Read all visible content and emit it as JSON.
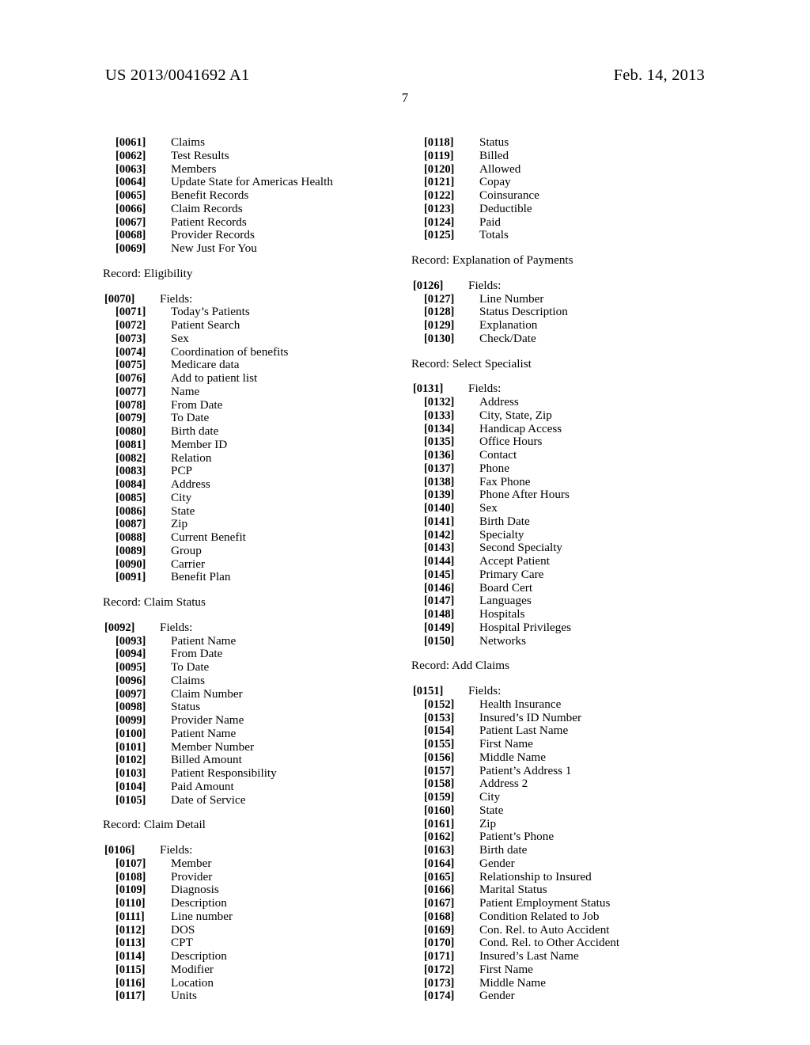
{
  "header": {
    "publication_number": "US 2013/0041692 A1",
    "publication_date": "Feb. 14, 2013",
    "page_number": "7"
  },
  "left_column": [
    {
      "type": "entry",
      "level": 2,
      "num": "[0061]",
      "label": "Claims"
    },
    {
      "type": "entry",
      "level": 2,
      "num": "[0062]",
      "label": "Test Results"
    },
    {
      "type": "entry",
      "level": 2,
      "num": "[0063]",
      "label": "Members"
    },
    {
      "type": "entry",
      "level": 2,
      "num": "[0064]",
      "label": "Update State for Americas Health"
    },
    {
      "type": "entry",
      "level": 2,
      "num": "[0065]",
      "label": "Benefit Records"
    },
    {
      "type": "entry",
      "level": 2,
      "num": "[0066]",
      "label": "Claim Records"
    },
    {
      "type": "entry",
      "level": 2,
      "num": "[0067]",
      "label": "Patient Records"
    },
    {
      "type": "entry",
      "level": 2,
      "num": "[0068]",
      "label": "Provider Records"
    },
    {
      "type": "entry",
      "level": 2,
      "num": "[0069]",
      "label": "New Just For You"
    },
    {
      "type": "gap"
    },
    {
      "type": "record",
      "text": "Record: Eligibility"
    },
    {
      "type": "gap"
    },
    {
      "type": "entry",
      "level": 1,
      "num": "[0070]",
      "label": "Fields:"
    },
    {
      "type": "entry",
      "level": 2,
      "num": "[0071]",
      "label": "Today’s Patients"
    },
    {
      "type": "entry",
      "level": 2,
      "num": "[0072]",
      "label": "Patient Search"
    },
    {
      "type": "entry",
      "level": 2,
      "num": "[0073]",
      "label": "Sex"
    },
    {
      "type": "entry",
      "level": 2,
      "num": "[0074]",
      "label": "Coordination of benefits"
    },
    {
      "type": "entry",
      "level": 2,
      "num": "[0075]",
      "label": "Medicare data"
    },
    {
      "type": "entry",
      "level": 2,
      "num": "[0076]",
      "label": "Add to patient list"
    },
    {
      "type": "entry",
      "level": 2,
      "num": "[0077]",
      "label": "Name"
    },
    {
      "type": "entry",
      "level": 2,
      "num": "[0078]",
      "label": "From Date"
    },
    {
      "type": "entry",
      "level": 2,
      "num": "[0079]",
      "label": "To Date"
    },
    {
      "type": "entry",
      "level": 2,
      "num": "[0080]",
      "label": "Birth date"
    },
    {
      "type": "entry",
      "level": 2,
      "num": "[0081]",
      "label": "Member ID"
    },
    {
      "type": "entry",
      "level": 2,
      "num": "[0082]",
      "label": "Relation"
    },
    {
      "type": "entry",
      "level": 2,
      "num": "[0083]",
      "label": "PCP"
    },
    {
      "type": "entry",
      "level": 2,
      "num": "[0084]",
      "label": "Address"
    },
    {
      "type": "entry",
      "level": 2,
      "num": "[0085]",
      "label": "City"
    },
    {
      "type": "entry",
      "level": 2,
      "num": "[0086]",
      "label": "State"
    },
    {
      "type": "entry",
      "level": 2,
      "num": "[0087]",
      "label": "Zip"
    },
    {
      "type": "entry",
      "level": 2,
      "num": "[0088]",
      "label": "Current Benefit"
    },
    {
      "type": "entry",
      "level": 2,
      "num": "[0089]",
      "label": "Group"
    },
    {
      "type": "entry",
      "level": 2,
      "num": "[0090]",
      "label": "Carrier"
    },
    {
      "type": "entry",
      "level": 2,
      "num": "[0091]",
      "label": "Benefit Plan"
    },
    {
      "type": "gap"
    },
    {
      "type": "record",
      "text": "Record: Claim Status"
    },
    {
      "type": "gap"
    },
    {
      "type": "entry",
      "level": 1,
      "num": "[0092]",
      "label": "Fields:"
    },
    {
      "type": "entry",
      "level": 2,
      "num": "[0093]",
      "label": "Patient Name"
    },
    {
      "type": "entry",
      "level": 2,
      "num": "[0094]",
      "label": "From Date"
    },
    {
      "type": "entry",
      "level": 2,
      "num": "[0095]",
      "label": "To Date"
    },
    {
      "type": "entry",
      "level": 2,
      "num": "[0096]",
      "label": "Claims"
    },
    {
      "type": "entry",
      "level": 2,
      "num": "[0097]",
      "label": "Claim Number"
    },
    {
      "type": "entry",
      "level": 2,
      "num": "[0098]",
      "label": "Status"
    },
    {
      "type": "entry",
      "level": 2,
      "num": "[0099]",
      "label": "Provider Name"
    },
    {
      "type": "entry",
      "level": 2,
      "num": "[0100]",
      "label": "Patient Name"
    },
    {
      "type": "entry",
      "level": 2,
      "num": "[0101]",
      "label": "Member Number"
    },
    {
      "type": "entry",
      "level": 2,
      "num": "[0102]",
      "label": "Billed Amount"
    },
    {
      "type": "entry",
      "level": 2,
      "num": "[0103]",
      "label": "Patient Responsibility"
    },
    {
      "type": "entry",
      "level": 2,
      "num": "[0104]",
      "label": "Paid Amount"
    },
    {
      "type": "entry",
      "level": 2,
      "num": "[0105]",
      "label": "Date of Service"
    },
    {
      "type": "gap"
    },
    {
      "type": "record",
      "text": "Record: Claim Detail"
    },
    {
      "type": "gap"
    },
    {
      "type": "entry",
      "level": 1,
      "num": "[0106]",
      "label": "Fields:"
    },
    {
      "type": "entry",
      "level": 2,
      "num": "[0107]",
      "label": "Member"
    },
    {
      "type": "entry",
      "level": 2,
      "num": "[0108]",
      "label": "Provider"
    },
    {
      "type": "entry",
      "level": 2,
      "num": "[0109]",
      "label": "Diagnosis"
    },
    {
      "type": "entry",
      "level": 2,
      "num": "[0110]",
      "label": "Description"
    },
    {
      "type": "entry",
      "level": 2,
      "num": "[0111]",
      "label": "Line number"
    },
    {
      "type": "entry",
      "level": 2,
      "num": "[0112]",
      "label": "DOS"
    },
    {
      "type": "entry",
      "level": 2,
      "num": "[0113]",
      "label": "CPT"
    },
    {
      "type": "entry",
      "level": 2,
      "num": "[0114]",
      "label": "Description"
    },
    {
      "type": "entry",
      "level": 2,
      "num": "[0115]",
      "label": "Modifier"
    },
    {
      "type": "entry",
      "level": 2,
      "num": "[0116]",
      "label": "Location"
    },
    {
      "type": "entry",
      "level": 2,
      "num": "[0117]",
      "label": "Units"
    }
  ],
  "right_column": [
    {
      "type": "entry",
      "level": 2,
      "num": "[0118]",
      "label": "Status"
    },
    {
      "type": "entry",
      "level": 2,
      "num": "[0119]",
      "label": "Billed"
    },
    {
      "type": "entry",
      "level": 2,
      "num": "[0120]",
      "label": "Allowed"
    },
    {
      "type": "entry",
      "level": 2,
      "num": "[0121]",
      "label": "Copay"
    },
    {
      "type": "entry",
      "level": 2,
      "num": "[0122]",
      "label": "Coinsurance"
    },
    {
      "type": "entry",
      "level": 2,
      "num": "[0123]",
      "label": "Deductible"
    },
    {
      "type": "entry",
      "level": 2,
      "num": "[0124]",
      "label": "Paid"
    },
    {
      "type": "entry",
      "level": 2,
      "num": "[0125]",
      "label": "Totals"
    },
    {
      "type": "gap"
    },
    {
      "type": "record",
      "text": "Record: Explanation of Payments"
    },
    {
      "type": "gap"
    },
    {
      "type": "entry",
      "level": 1,
      "num": "[0126]",
      "label": "Fields:"
    },
    {
      "type": "entry",
      "level": 2,
      "num": "[0127]",
      "label": "Line Number"
    },
    {
      "type": "entry",
      "level": 2,
      "num": "[0128]",
      "label": "Status Description"
    },
    {
      "type": "entry",
      "level": 2,
      "num": "[0129]",
      "label": "Explanation"
    },
    {
      "type": "entry",
      "level": 2,
      "num": "[0130]",
      "label": "Check/Date"
    },
    {
      "type": "gap"
    },
    {
      "type": "record",
      "text": "Record: Select Specialist"
    },
    {
      "type": "gap"
    },
    {
      "type": "entry",
      "level": 1,
      "num": "[0131]",
      "label": "Fields:"
    },
    {
      "type": "entry",
      "level": 2,
      "num": "[0132]",
      "label": "Address"
    },
    {
      "type": "entry",
      "level": 2,
      "num": "[0133]",
      "label": "City, State, Zip"
    },
    {
      "type": "entry",
      "level": 2,
      "num": "[0134]",
      "label": "Handicap Access"
    },
    {
      "type": "entry",
      "level": 2,
      "num": "[0135]",
      "label": "Office Hours"
    },
    {
      "type": "entry",
      "level": 2,
      "num": "[0136]",
      "label": "Contact"
    },
    {
      "type": "entry",
      "level": 2,
      "num": "[0137]",
      "label": "Phone"
    },
    {
      "type": "entry",
      "level": 2,
      "num": "[0138]",
      "label": "Fax Phone"
    },
    {
      "type": "entry",
      "level": 2,
      "num": "[0139]",
      "label": "Phone After Hours"
    },
    {
      "type": "entry",
      "level": 2,
      "num": "[0140]",
      "label": "Sex"
    },
    {
      "type": "entry",
      "level": 2,
      "num": "[0141]",
      "label": "Birth Date"
    },
    {
      "type": "entry",
      "level": 2,
      "num": "[0142]",
      "label": "Specialty"
    },
    {
      "type": "entry",
      "level": 2,
      "num": "[0143]",
      "label": "Second Specialty"
    },
    {
      "type": "entry",
      "level": 2,
      "num": "[0144]",
      "label": "Accept Patient"
    },
    {
      "type": "entry",
      "level": 2,
      "num": "[0145]",
      "label": "Primary Care"
    },
    {
      "type": "entry",
      "level": 2,
      "num": "[0146]",
      "label": "Board Cert"
    },
    {
      "type": "entry",
      "level": 2,
      "num": "[0147]",
      "label": "Languages"
    },
    {
      "type": "entry",
      "level": 2,
      "num": "[0148]",
      "label": "Hospitals"
    },
    {
      "type": "entry",
      "level": 2,
      "num": "[0149]",
      "label": "Hospital Privileges"
    },
    {
      "type": "entry",
      "level": 2,
      "num": "[0150]",
      "label": "Networks"
    },
    {
      "type": "gap"
    },
    {
      "type": "record",
      "text": "Record: Add Claims"
    },
    {
      "type": "gap"
    },
    {
      "type": "entry",
      "level": 1,
      "num": "[0151]",
      "label": "Fields:"
    },
    {
      "type": "entry",
      "level": 2,
      "num": "[0152]",
      "label": "Health Insurance"
    },
    {
      "type": "entry",
      "level": 2,
      "num": "[0153]",
      "label": "Insured’s ID Number"
    },
    {
      "type": "entry",
      "level": 2,
      "num": "[0154]",
      "label": "Patient Last Name"
    },
    {
      "type": "entry",
      "level": 2,
      "num": "[0155]",
      "label": "First Name"
    },
    {
      "type": "entry",
      "level": 2,
      "num": "[0156]",
      "label": "Middle Name"
    },
    {
      "type": "entry",
      "level": 2,
      "num": "[0157]",
      "label": "Patient’s Address 1"
    },
    {
      "type": "entry",
      "level": 2,
      "num": "[0158]",
      "label": "Address 2"
    },
    {
      "type": "entry",
      "level": 2,
      "num": "[0159]",
      "label": "City"
    },
    {
      "type": "entry",
      "level": 2,
      "num": "[0160]",
      "label": "State"
    },
    {
      "type": "entry",
      "level": 2,
      "num": "[0161]",
      "label": "Zip"
    },
    {
      "type": "entry",
      "level": 2,
      "num": "[0162]",
      "label": "Patient’s Phone"
    },
    {
      "type": "entry",
      "level": 2,
      "num": "[0163]",
      "label": "Birth date"
    },
    {
      "type": "entry",
      "level": 2,
      "num": "[0164]",
      "label": "Gender"
    },
    {
      "type": "entry",
      "level": 2,
      "num": "[0165]",
      "label": "Relationship to Insured"
    },
    {
      "type": "entry",
      "level": 2,
      "num": "[0166]",
      "label": "Marital Status"
    },
    {
      "type": "entry",
      "level": 2,
      "num": "[0167]",
      "label": "Patient Employment Status"
    },
    {
      "type": "entry",
      "level": 2,
      "num": "[0168]",
      "label": "Condition Related to Job"
    },
    {
      "type": "entry",
      "level": 2,
      "num": "[0169]",
      "label": "Con. Rel. to Auto Accident"
    },
    {
      "type": "entry",
      "level": 2,
      "num": "[0170]",
      "label": "Cond. Rel. to Other Accident"
    },
    {
      "type": "entry",
      "level": 2,
      "num": "[0171]",
      "label": "Insured’s Last Name"
    },
    {
      "type": "entry",
      "level": 2,
      "num": "[0172]",
      "label": "First Name"
    },
    {
      "type": "entry",
      "level": 2,
      "num": "[0173]",
      "label": "Middle Name"
    },
    {
      "type": "entry",
      "level": 2,
      "num": "[0174]",
      "label": "Gender"
    }
  ]
}
